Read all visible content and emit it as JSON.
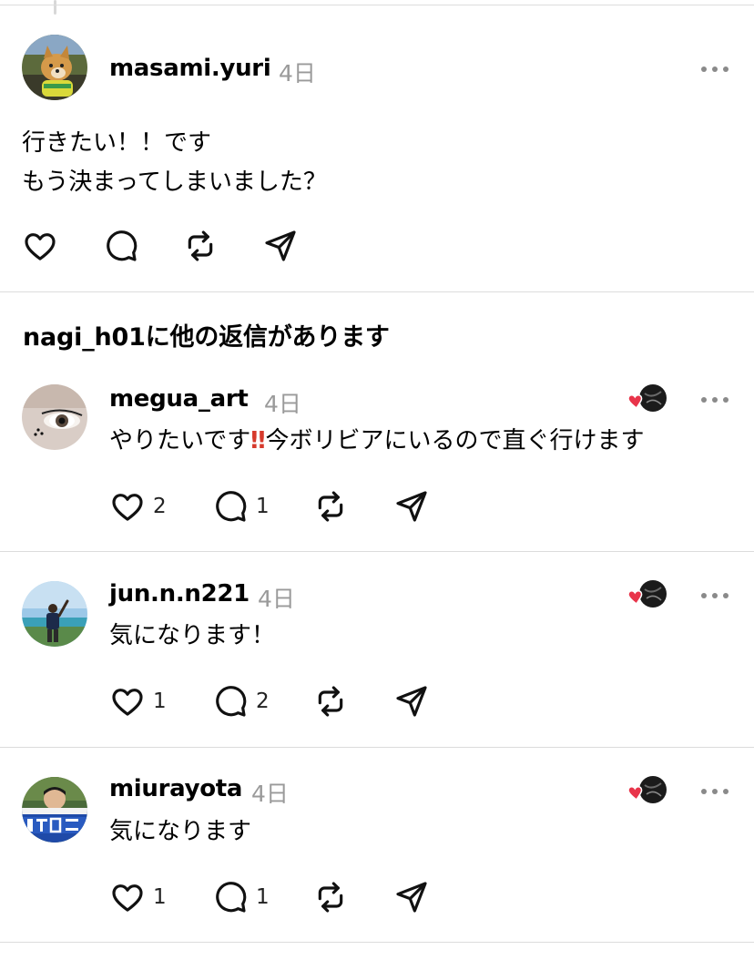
{
  "top_post": {
    "username": "masami.yuri",
    "time": "4日",
    "line1": "行きたい！！です",
    "line2": "もう決まってしまいました？",
    "avatar_icon": "shiba-dog-avatar"
  },
  "more_replies": {
    "header": "nagi_h01に他の返信があります"
  },
  "replies": [
    {
      "username": "megua_art",
      "time": "4日",
      "text_before": "やりたいです",
      "emoji": "‼",
      "text_after": "今ボリビアにいるので直ぐ行けます",
      "likes": "2",
      "comments": "1"
    },
    {
      "username": "jun.n.n221",
      "time": "4日",
      "text": "気になります！",
      "likes": "1",
      "comments": "2"
    },
    {
      "username": "miurayota",
      "time": "4日",
      "text": "気になります",
      "likes": "1",
      "comments": "1"
    }
  ],
  "colors": {
    "like_heart": "#e8344a",
    "muted": "#9a9a9a",
    "divider": "#dcdcdc"
  }
}
